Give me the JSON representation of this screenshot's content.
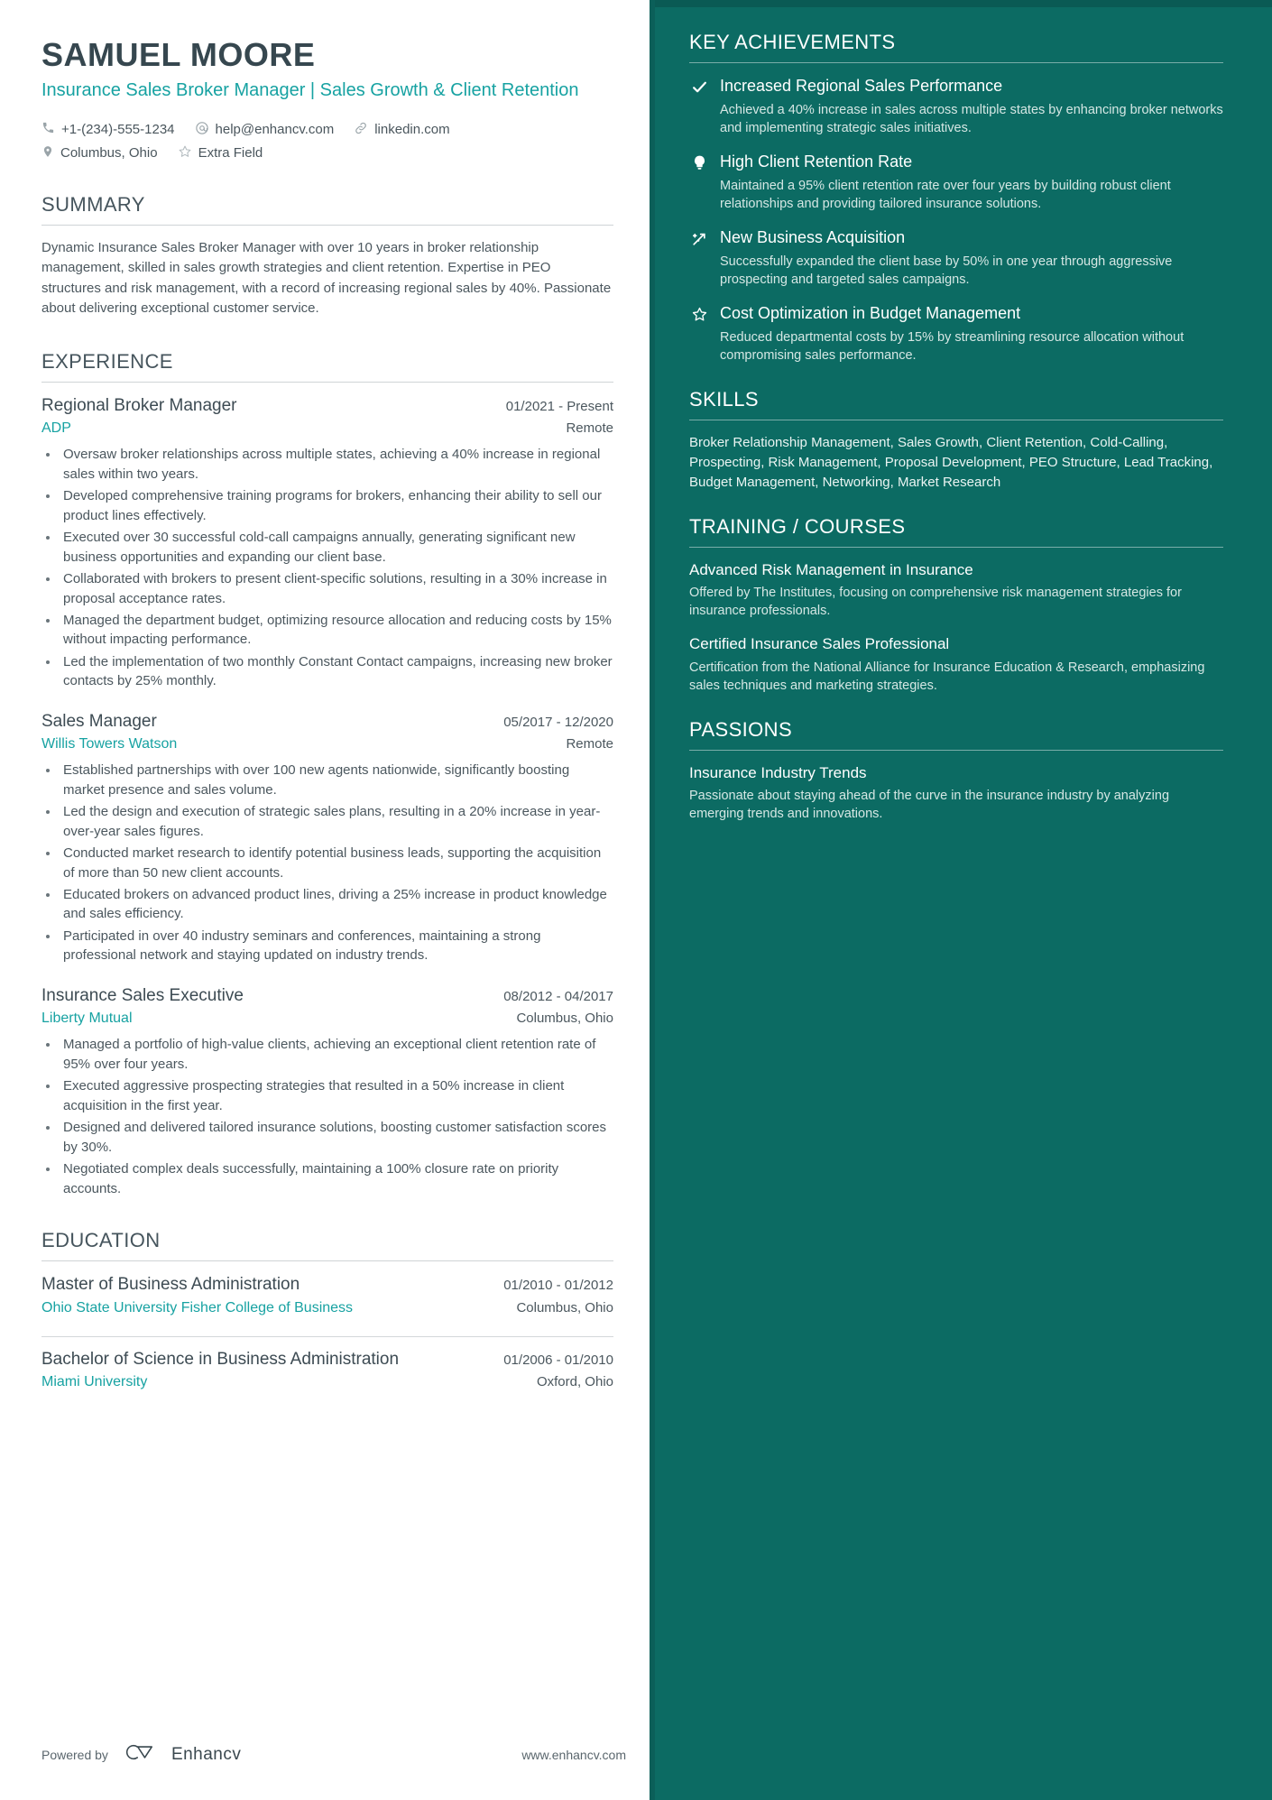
{
  "header": {
    "name": "SAMUEL MOORE",
    "headline": "Insurance Sales Broker Manager | Sales Growth & Client Retention",
    "contacts_row1": [
      {
        "icon": "phone-icon",
        "text": "+1-(234)-555-1234"
      },
      {
        "icon": "email-icon",
        "text": "help@enhancv.com"
      },
      {
        "icon": "link-icon",
        "text": "linkedin.com"
      }
    ],
    "contacts_row2": [
      {
        "icon": "location-pin-icon",
        "text": "Columbus, Ohio"
      },
      {
        "icon": "star-icon",
        "text": "Extra Field"
      }
    ]
  },
  "summary": {
    "title": "SUMMARY",
    "text": "Dynamic Insurance Sales Broker Manager with over 10 years in broker relationship management, skilled in sales growth strategies and client retention. Expertise in PEO structures and risk management, with a record of increasing regional sales by 40%. Passionate about delivering exceptional customer service."
  },
  "experience": {
    "title": "EXPERIENCE",
    "entries": [
      {
        "role": "Regional Broker Manager",
        "date": "01/2021 - Present",
        "company": "ADP",
        "location": "Remote",
        "bullets": [
          "Oversaw broker relationships across multiple states, achieving a 40% increase in regional sales within two years.",
          "Developed comprehensive training programs for brokers, enhancing their ability to sell our product lines effectively.",
          "Executed over 30 successful cold-call campaigns annually, generating significant new business opportunities and expanding our client base.",
          "Collaborated with brokers to present client-specific solutions, resulting in a 30% increase in proposal acceptance rates.",
          "Managed the department budget, optimizing resource allocation and reducing costs by 15% without impacting performance.",
          "Led the implementation of two monthly Constant Contact campaigns, increasing new broker contacts by 25% monthly."
        ]
      },
      {
        "role": "Sales Manager",
        "date": "05/2017 - 12/2020",
        "company": "Willis Towers Watson",
        "location": "Remote",
        "bullets": [
          "Established partnerships with over 100 new agents nationwide, significantly boosting market presence and sales volume.",
          "Led the design and execution of strategic sales plans, resulting in a 20% increase in year-over-year sales figures.",
          "Conducted market research to identify potential business leads, supporting the acquisition of more than 50 new client accounts.",
          "Educated brokers on advanced product lines, driving a 25% increase in product knowledge and sales efficiency.",
          "Participated in over 40 industry seminars and conferences, maintaining a strong professional network and staying updated on industry trends."
        ]
      },
      {
        "role": "Insurance Sales Executive",
        "date": "08/2012 - 04/2017",
        "company": "Liberty Mutual",
        "location": "Columbus, Ohio",
        "bullets": [
          "Managed a portfolio of high-value clients, achieving an exceptional client retention rate of 95% over four years.",
          "Executed aggressive prospecting strategies that resulted in a 50% increase in client acquisition in the first year.",
          "Designed and delivered tailored insurance solutions, boosting customer satisfaction scores by 30%.",
          "Negotiated complex deals successfully, maintaining a 100% closure rate on priority accounts."
        ]
      }
    ]
  },
  "education": {
    "title": "EDUCATION",
    "entries": [
      {
        "degree": "Master of Business Administration",
        "date": "01/2010 - 01/2012",
        "school": "Ohio State University Fisher College of Business",
        "location": "Columbus, Ohio"
      },
      {
        "degree": "Bachelor of Science in Business Administration",
        "date": "01/2006 - 01/2010",
        "school": "Miami University",
        "location": "Oxford, Ohio"
      }
    ]
  },
  "achievements": {
    "title": "KEY ACHIEVEMENTS",
    "items": [
      {
        "icon": "check-icon",
        "title": "Increased Regional Sales Performance",
        "desc": "Achieved a 40% increase in sales across multiple states by enhancing broker networks and implementing strategic sales initiatives."
      },
      {
        "icon": "lightbulb-icon",
        "title": "High Client Retention Rate",
        "desc": "Maintained a 95% client retention rate over four years by building robust client relationships and providing tailored insurance solutions."
      },
      {
        "icon": "shooting-star-icon",
        "title": "New Business Acquisition",
        "desc": "Successfully expanded the client base by 50% in one year through aggressive prospecting and targeted sales campaigns."
      },
      {
        "icon": "star-outline-icon",
        "title": "Cost Optimization in Budget Management",
        "desc": "Reduced departmental costs by 15% by streamlining resource allocation without compromising sales performance."
      }
    ]
  },
  "skills": {
    "title": "SKILLS",
    "text": "Broker Relationship Management, Sales Growth, Client Retention, Cold-Calling, Prospecting, Risk Management, Proposal Development, PEO Structure, Lead Tracking, Budget Management, Networking, Market Research"
  },
  "training": {
    "title": "TRAINING / COURSES",
    "items": [
      {
        "name": "Advanced Risk Management in Insurance",
        "desc": "Offered by The Institutes, focusing on comprehensive risk management strategies for insurance professionals."
      },
      {
        "name": "Certified Insurance Sales Professional",
        "desc": "Certification from the National Alliance for Insurance Education & Research, emphasizing sales techniques and marketing strategies."
      }
    ]
  },
  "passions": {
    "title": "PASSIONS",
    "items": [
      {
        "name": "Insurance Industry Trends",
        "desc": "Passionate about staying ahead of the curve in the insurance industry by analyzing emerging trends and innovations."
      }
    ]
  },
  "footer": {
    "powered_by": "Powered by",
    "brand": "Enhancv",
    "url": "www.enhancv.com"
  },
  "colors": {
    "accent_teal": "#17a2a2",
    "sidebar_bg": "#0c6b63",
    "heading": "#3d4b53"
  }
}
